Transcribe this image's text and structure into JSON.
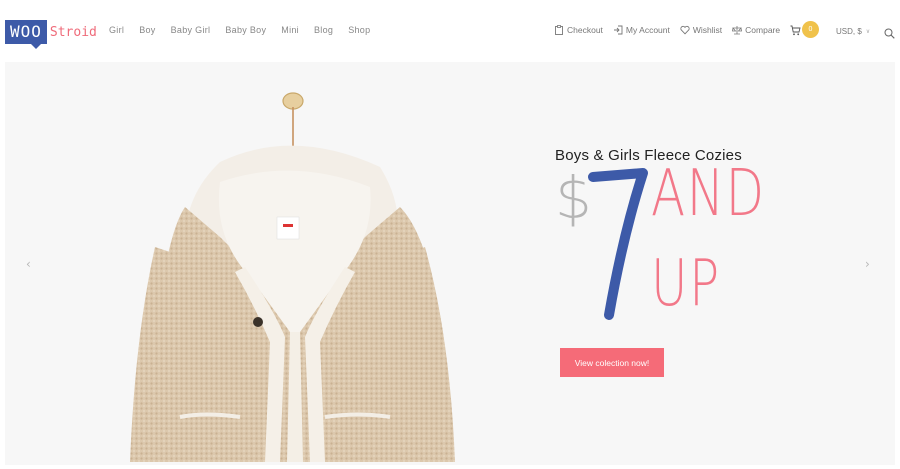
{
  "logo": {
    "box_text": "WOO",
    "text": "Stroid"
  },
  "nav": {
    "items": [
      "Girl",
      "Boy",
      "Baby Girl",
      "Baby Boy",
      "Mini",
      "Blog",
      "Shop"
    ]
  },
  "account": {
    "checkout": "Checkout",
    "my_account": "My Account",
    "wishlist": "Wishlist",
    "compare": "Compare"
  },
  "cart": {
    "count": "0"
  },
  "currency": {
    "label": "USD, $"
  },
  "slide": {
    "subtitle": "Boys & Girls Fleece Cozies",
    "currency_symbol": "$",
    "price": "7",
    "line1": "AND",
    "line2": "UP",
    "cta_label": "View colection now!"
  },
  "colors": {
    "brand_blue": "#3d5aa8",
    "accent_pink": "#f56b78",
    "cart_badge": "#f0c24b"
  },
  "icons": [
    "clipboard-icon",
    "login-icon",
    "heart-icon",
    "compare-icon",
    "cart-icon",
    "search-icon",
    "chevron-left-icon",
    "chevron-right-icon"
  ]
}
